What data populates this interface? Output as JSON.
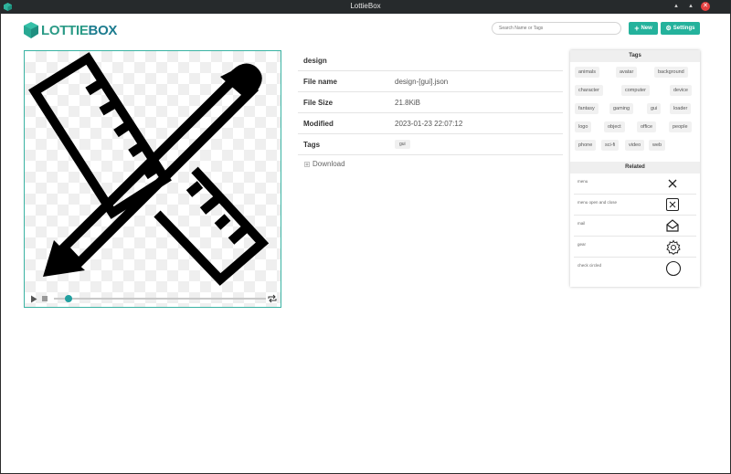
{
  "window": {
    "title": "LottieBox"
  },
  "brand": {
    "name_part1": "LOTTIE",
    "name_part2": "BOX"
  },
  "header": {
    "search_placeholder": "Search Name or Tags",
    "new_label": "New",
    "settings_label": "Settings"
  },
  "details": {
    "title": "design",
    "rows": [
      {
        "label": "File name",
        "value": "design-[gui].json"
      },
      {
        "label": "File Size",
        "value": "21.8KiB"
      },
      {
        "label": "Modified",
        "value": "2023-01-23 22:07:12"
      }
    ],
    "tags_label": "Tags",
    "tag_value": "gui",
    "download_label": "Download"
  },
  "player": {
    "progress": 0.07
  },
  "sidebar": {
    "tags_heading": "Tags",
    "tags": [
      "animals",
      "avatar",
      "background",
      "character",
      "computer",
      "device",
      "fantasy",
      "gaming",
      "gui",
      "loader",
      "logo",
      "object",
      "office",
      "people",
      "phone",
      "sci-fi",
      "video",
      "web"
    ],
    "related_heading": "Related",
    "related": [
      {
        "name": "menu",
        "icon": "close-x-icon"
      },
      {
        "name": "menu open and close",
        "icon": "close-box-icon"
      },
      {
        "name": "mail",
        "icon": "mail-open-icon"
      },
      {
        "name": "gear",
        "icon": "gear-icon"
      },
      {
        "name": "check circled",
        "icon": "circle-icon"
      }
    ]
  },
  "colors": {
    "accent": "#24b29c",
    "brand_dark": "#1d7c8f",
    "titlebar": "#262a2c"
  }
}
